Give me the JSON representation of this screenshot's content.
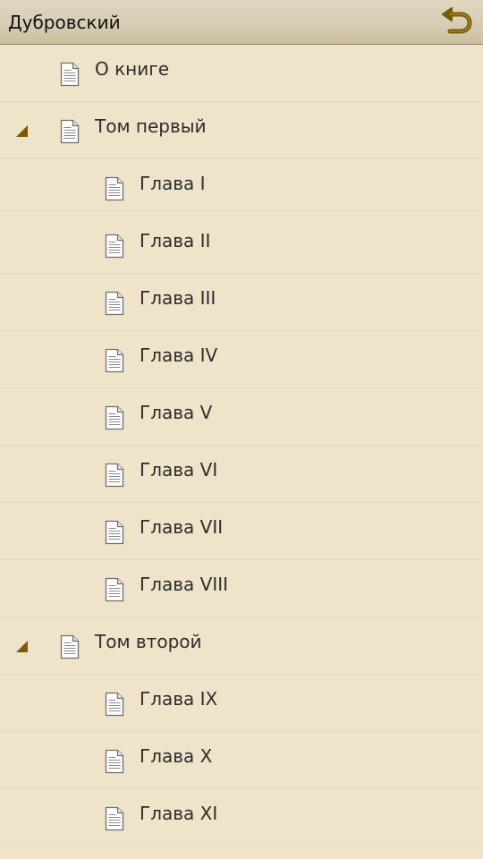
{
  "header": {
    "title": "Дубровский",
    "back_icon": "undo-arrow-icon"
  },
  "colors": {
    "background": "#efe3ca",
    "header": "#d7ccb4",
    "accent": "#7a5a06",
    "text": "#2d2d2d"
  },
  "toc": [
    {
      "label": "О книге",
      "level": 0,
      "toggle": false
    },
    {
      "label": "Том первый",
      "level": 0,
      "toggle": true
    },
    {
      "label": "Глава I",
      "level": 1,
      "toggle": false
    },
    {
      "label": "Глава II",
      "level": 1,
      "toggle": false
    },
    {
      "label": "Глава III",
      "level": 1,
      "toggle": false
    },
    {
      "label": "Глава IV",
      "level": 1,
      "toggle": false
    },
    {
      "label": "Глава V",
      "level": 1,
      "toggle": false
    },
    {
      "label": "Глава VI",
      "level": 1,
      "toggle": false
    },
    {
      "label": "Глава VII",
      "level": 1,
      "toggle": false
    },
    {
      "label": "Глава VIII",
      "level": 1,
      "toggle": false
    },
    {
      "label": "Том второй",
      "level": 0,
      "toggle": true
    },
    {
      "label": "Глава IX",
      "level": 1,
      "toggle": false
    },
    {
      "label": "Глава X",
      "level": 1,
      "toggle": false
    },
    {
      "label": "Глава XI",
      "level": 1,
      "toggle": false
    }
  ]
}
